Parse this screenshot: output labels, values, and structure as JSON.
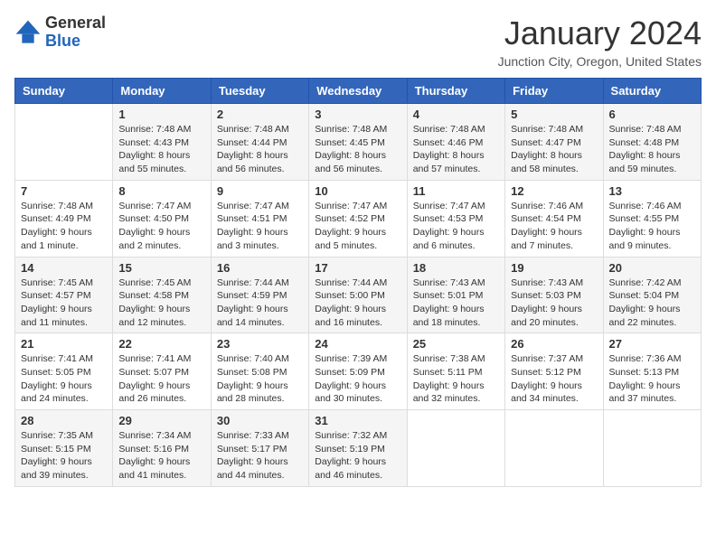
{
  "logo": {
    "line1": "General",
    "line2": "Blue"
  },
  "title": "January 2024",
  "location": "Junction City, Oregon, United States",
  "weekdays": [
    "Sunday",
    "Monday",
    "Tuesday",
    "Wednesday",
    "Thursday",
    "Friday",
    "Saturday"
  ],
  "weeks": [
    [
      {
        "day": "",
        "sunrise": "",
        "sunset": "",
        "daylight": ""
      },
      {
        "day": "1",
        "sunrise": "Sunrise: 7:48 AM",
        "sunset": "Sunset: 4:43 PM",
        "daylight": "Daylight: 8 hours and 55 minutes."
      },
      {
        "day": "2",
        "sunrise": "Sunrise: 7:48 AM",
        "sunset": "Sunset: 4:44 PM",
        "daylight": "Daylight: 8 hours and 56 minutes."
      },
      {
        "day": "3",
        "sunrise": "Sunrise: 7:48 AM",
        "sunset": "Sunset: 4:45 PM",
        "daylight": "Daylight: 8 hours and 56 minutes."
      },
      {
        "day": "4",
        "sunrise": "Sunrise: 7:48 AM",
        "sunset": "Sunset: 4:46 PM",
        "daylight": "Daylight: 8 hours and 57 minutes."
      },
      {
        "day": "5",
        "sunrise": "Sunrise: 7:48 AM",
        "sunset": "Sunset: 4:47 PM",
        "daylight": "Daylight: 8 hours and 58 minutes."
      },
      {
        "day": "6",
        "sunrise": "Sunrise: 7:48 AM",
        "sunset": "Sunset: 4:48 PM",
        "daylight": "Daylight: 8 hours and 59 minutes."
      }
    ],
    [
      {
        "day": "7",
        "sunrise": "Sunrise: 7:48 AM",
        "sunset": "Sunset: 4:49 PM",
        "daylight": "Daylight: 9 hours and 1 minute."
      },
      {
        "day": "8",
        "sunrise": "Sunrise: 7:47 AM",
        "sunset": "Sunset: 4:50 PM",
        "daylight": "Daylight: 9 hours and 2 minutes."
      },
      {
        "day": "9",
        "sunrise": "Sunrise: 7:47 AM",
        "sunset": "Sunset: 4:51 PM",
        "daylight": "Daylight: 9 hours and 3 minutes."
      },
      {
        "day": "10",
        "sunrise": "Sunrise: 7:47 AM",
        "sunset": "Sunset: 4:52 PM",
        "daylight": "Daylight: 9 hours and 5 minutes."
      },
      {
        "day": "11",
        "sunrise": "Sunrise: 7:47 AM",
        "sunset": "Sunset: 4:53 PM",
        "daylight": "Daylight: 9 hours and 6 minutes."
      },
      {
        "day": "12",
        "sunrise": "Sunrise: 7:46 AM",
        "sunset": "Sunset: 4:54 PM",
        "daylight": "Daylight: 9 hours and 7 minutes."
      },
      {
        "day": "13",
        "sunrise": "Sunrise: 7:46 AM",
        "sunset": "Sunset: 4:55 PM",
        "daylight": "Daylight: 9 hours and 9 minutes."
      }
    ],
    [
      {
        "day": "14",
        "sunrise": "Sunrise: 7:45 AM",
        "sunset": "Sunset: 4:57 PM",
        "daylight": "Daylight: 9 hours and 11 minutes."
      },
      {
        "day": "15",
        "sunrise": "Sunrise: 7:45 AM",
        "sunset": "Sunset: 4:58 PM",
        "daylight": "Daylight: 9 hours and 12 minutes."
      },
      {
        "day": "16",
        "sunrise": "Sunrise: 7:44 AM",
        "sunset": "Sunset: 4:59 PM",
        "daylight": "Daylight: 9 hours and 14 minutes."
      },
      {
        "day": "17",
        "sunrise": "Sunrise: 7:44 AM",
        "sunset": "Sunset: 5:00 PM",
        "daylight": "Daylight: 9 hours and 16 minutes."
      },
      {
        "day": "18",
        "sunrise": "Sunrise: 7:43 AM",
        "sunset": "Sunset: 5:01 PM",
        "daylight": "Daylight: 9 hours and 18 minutes."
      },
      {
        "day": "19",
        "sunrise": "Sunrise: 7:43 AM",
        "sunset": "Sunset: 5:03 PM",
        "daylight": "Daylight: 9 hours and 20 minutes."
      },
      {
        "day": "20",
        "sunrise": "Sunrise: 7:42 AM",
        "sunset": "Sunset: 5:04 PM",
        "daylight": "Daylight: 9 hours and 22 minutes."
      }
    ],
    [
      {
        "day": "21",
        "sunrise": "Sunrise: 7:41 AM",
        "sunset": "Sunset: 5:05 PM",
        "daylight": "Daylight: 9 hours and 24 minutes."
      },
      {
        "day": "22",
        "sunrise": "Sunrise: 7:41 AM",
        "sunset": "Sunset: 5:07 PM",
        "daylight": "Daylight: 9 hours and 26 minutes."
      },
      {
        "day": "23",
        "sunrise": "Sunrise: 7:40 AM",
        "sunset": "Sunset: 5:08 PM",
        "daylight": "Daylight: 9 hours and 28 minutes."
      },
      {
        "day": "24",
        "sunrise": "Sunrise: 7:39 AM",
        "sunset": "Sunset: 5:09 PM",
        "daylight": "Daylight: 9 hours and 30 minutes."
      },
      {
        "day": "25",
        "sunrise": "Sunrise: 7:38 AM",
        "sunset": "Sunset: 5:11 PM",
        "daylight": "Daylight: 9 hours and 32 minutes."
      },
      {
        "day": "26",
        "sunrise": "Sunrise: 7:37 AM",
        "sunset": "Sunset: 5:12 PM",
        "daylight": "Daylight: 9 hours and 34 minutes."
      },
      {
        "day": "27",
        "sunrise": "Sunrise: 7:36 AM",
        "sunset": "Sunset: 5:13 PM",
        "daylight": "Daylight: 9 hours and 37 minutes."
      }
    ],
    [
      {
        "day": "28",
        "sunrise": "Sunrise: 7:35 AM",
        "sunset": "Sunset: 5:15 PM",
        "daylight": "Daylight: 9 hours and 39 minutes."
      },
      {
        "day": "29",
        "sunrise": "Sunrise: 7:34 AM",
        "sunset": "Sunset: 5:16 PM",
        "daylight": "Daylight: 9 hours and 41 minutes."
      },
      {
        "day": "30",
        "sunrise": "Sunrise: 7:33 AM",
        "sunset": "Sunset: 5:17 PM",
        "daylight": "Daylight: 9 hours and 44 minutes."
      },
      {
        "day": "31",
        "sunrise": "Sunrise: 7:32 AM",
        "sunset": "Sunset: 5:19 PM",
        "daylight": "Daylight: 9 hours and 46 minutes."
      },
      {
        "day": "",
        "sunrise": "",
        "sunset": "",
        "daylight": ""
      },
      {
        "day": "",
        "sunrise": "",
        "sunset": "",
        "daylight": ""
      },
      {
        "day": "",
        "sunrise": "",
        "sunset": "",
        "daylight": ""
      }
    ]
  ]
}
